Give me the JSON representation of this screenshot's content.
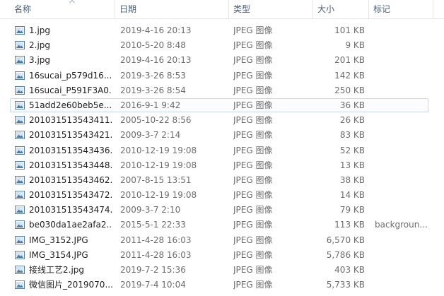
{
  "columns": {
    "name": "名称",
    "date": "日期",
    "type": "类型",
    "size": "大小",
    "tags": "标记"
  },
  "files": [
    {
      "name": "1.jpg",
      "date": "2019-4-16 20:13",
      "type": "JPEG 图像",
      "size": "101 KB",
      "tags": ""
    },
    {
      "name": "2.jpg",
      "date": "2010-5-20 8:48",
      "type": "JPEG 图像",
      "size": "9 KB",
      "tags": ""
    },
    {
      "name": "3.jpg",
      "date": "2019-4-16 20:13",
      "type": "JPEG 图像",
      "size": "201 KB",
      "tags": ""
    },
    {
      "name": "16sucai_p579d16...",
      "date": "2019-3-26 8:53",
      "type": "JPEG 图像",
      "size": "142 KB",
      "tags": ""
    },
    {
      "name": "16sucai_P591F3A0...",
      "date": "2019-3-26 8:54",
      "type": "JPEG 图像",
      "size": "250 KB",
      "tags": ""
    },
    {
      "name": "51add2e60beb5e...",
      "date": "2016-9-1 9:42",
      "type": "JPEG 图像",
      "size": "36 KB",
      "tags": "",
      "selected": true
    },
    {
      "name": "201031513543411...",
      "date": "2005-10-22 8:56",
      "type": "JPEG 图像",
      "size": "26 KB",
      "tags": ""
    },
    {
      "name": "201031513543421...",
      "date": "2009-3-7 2:14",
      "type": "JPEG 图像",
      "size": "83 KB",
      "tags": ""
    },
    {
      "name": "201031513543436...",
      "date": "2010-12-19 19:08",
      "type": "JPEG 图像",
      "size": "52 KB",
      "tags": ""
    },
    {
      "name": "201031513543448...",
      "date": "2010-12-19 19:08",
      "type": "JPEG 图像",
      "size": "13 KB",
      "tags": ""
    },
    {
      "name": "201031513543462...",
      "date": "2007-8-15 13:51",
      "type": "JPEG 图像",
      "size": "38 KB",
      "tags": ""
    },
    {
      "name": "201031513543472...",
      "date": "2010-12-19 19:08",
      "type": "JPEG 图像",
      "size": "14 KB",
      "tags": ""
    },
    {
      "name": "201031513543474...",
      "date": "2009-3-7 2:10",
      "type": "JPEG 图像",
      "size": "79 KB",
      "tags": ""
    },
    {
      "name": "be030da1ae2afa2...",
      "date": "2015-5-1 22:33",
      "type": "JPEG 图像",
      "size": "113 KB",
      "tags": "backgroun..."
    },
    {
      "name": "IMG_3152.JPG",
      "date": "2011-4-28 16:03",
      "type": "JPEG 图像",
      "size": "6,570 KB",
      "tags": ""
    },
    {
      "name": "IMG_3154.JPG",
      "date": "2011-4-28 16:03",
      "type": "JPEG 图像",
      "size": "5,786 KB",
      "tags": ""
    },
    {
      "name": "接线工艺2.jpg",
      "date": "2019-7-2 15:36",
      "type": "JPEG 图像",
      "size": "403 KB",
      "tags": ""
    },
    {
      "name": "微信图片_2019070...",
      "date": "2019-7-4 10:04",
      "type": "JPEG 图像",
      "size": "5,733 KB",
      "tags": ""
    }
  ],
  "icons": {
    "file": "image-file-icon",
    "sort": "sort-up-icon"
  },
  "colors": {
    "header_text": "#4c607a",
    "selection_border": "#c8d9f0",
    "secondary_text": "#6d6d6d"
  }
}
